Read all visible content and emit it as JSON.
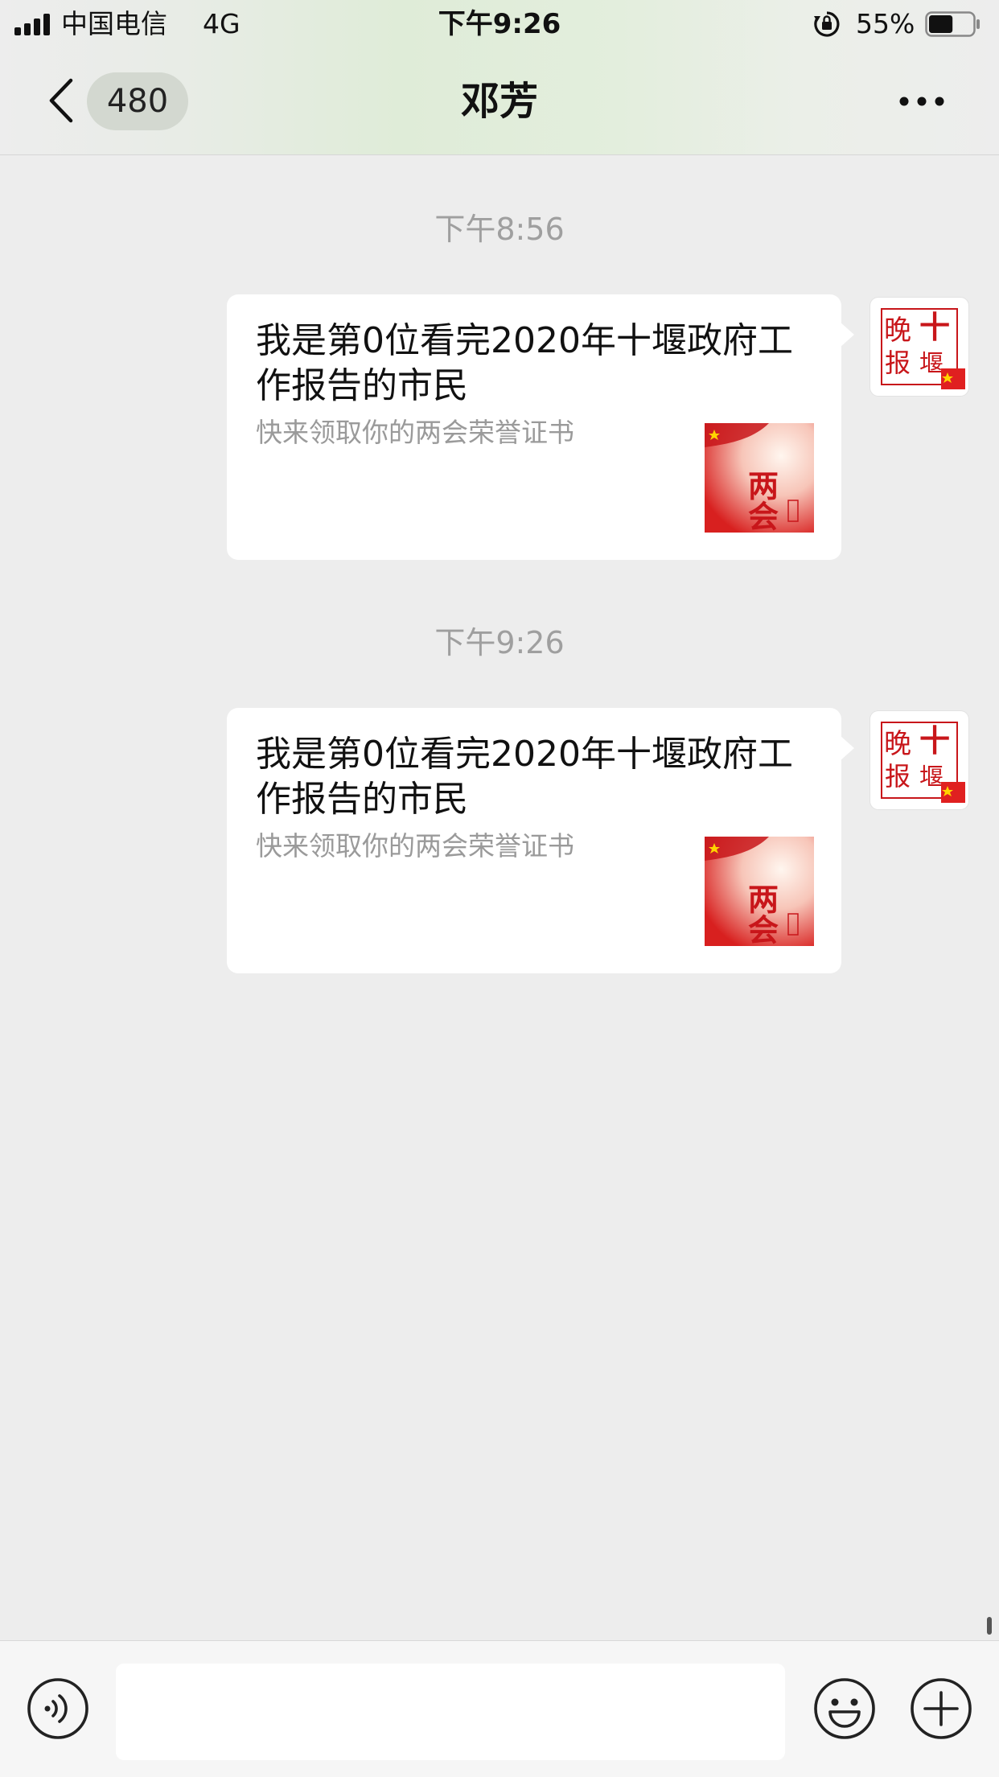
{
  "status_bar": {
    "carrier": "中国电信",
    "network": "4G",
    "time": "下午9:26",
    "battery_percent": "55%",
    "battery_level": 0.55,
    "icons": [
      "signal-icon",
      "rotation-lock-icon",
      "battery-icon"
    ]
  },
  "header": {
    "unread_count": "480",
    "title": "邓芳",
    "icons": [
      "back-chevron-icon",
      "more-dots-icon"
    ]
  },
  "messages": [
    {
      "timestamp": "下午8:56",
      "title": "我是第0位看完2020年十堰政府工作报告的市民",
      "description": "快来领取你的两会荣誉证书",
      "thumb_text": "两会",
      "avatar_text": [
        "晚",
        "十",
        "报",
        "堰"
      ]
    },
    {
      "timestamp": "下午9:26",
      "title": "我是第0位看完2020年十堰政府工作报告的市民",
      "description": "快来领取你的两会荣誉证书",
      "thumb_text": "两会",
      "avatar_text": [
        "晚",
        "十",
        "报",
        "堰"
      ]
    }
  ],
  "input_bar": {
    "placeholder": "",
    "icons": [
      "voice-icon",
      "emoji-icon",
      "plus-icon"
    ]
  },
  "colors": {
    "background": "#ededed",
    "bubble": "#ffffff",
    "timestamp": "#9f9f9f",
    "description": "#9a9a9a",
    "accent_red": "#d8201f"
  }
}
